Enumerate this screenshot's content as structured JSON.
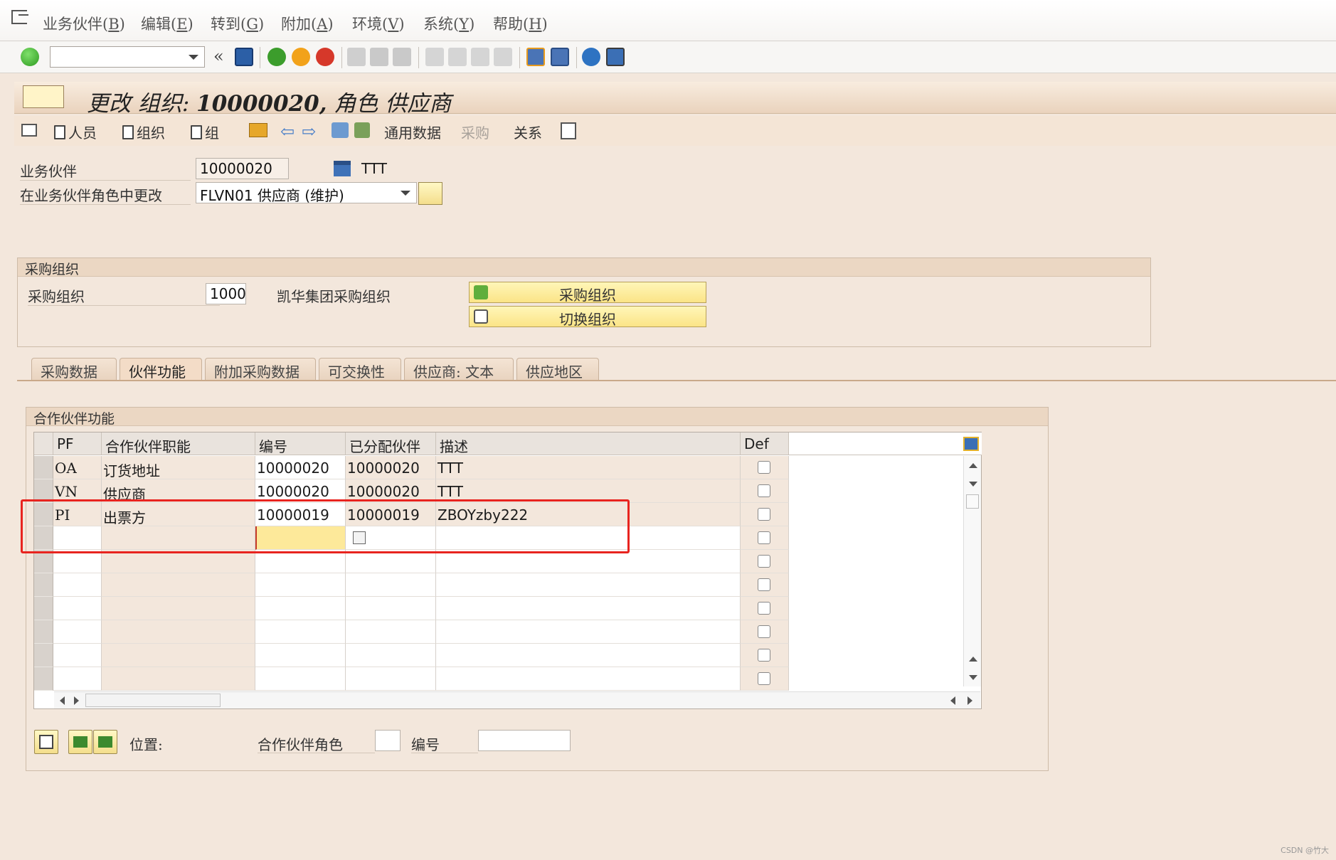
{
  "menu": {
    "items": [
      {
        "label": "业务伙伴(",
        "key": "B",
        "suffix": ")"
      },
      {
        "label": "编辑(",
        "key": "E",
        "suffix": ")"
      },
      {
        "label": "转到(",
        "key": "G",
        "suffix": ")"
      },
      {
        "label": "附加(",
        "key": "A",
        "suffix": ")"
      },
      {
        "label": "环境(",
        "key": "V",
        "suffix": ")"
      },
      {
        "label": "系统(",
        "key": "Y",
        "suffix": ")"
      },
      {
        "label": "帮助(",
        "key": "H",
        "suffix": ")"
      }
    ]
  },
  "title": {
    "prefix": "更改 组织: ",
    "number": "10000020,",
    "suffix": " 角色 供应商"
  },
  "app_toolbar": {
    "person": "人员",
    "organization": "组织",
    "group": "组",
    "general_data": "通用数据",
    "purchasing": "采购",
    "relations": "关系"
  },
  "header_fields": {
    "bp_label": "业务伙伴",
    "bp_value": "10000020",
    "bp_name": "TTT",
    "role_label": "在业务伙伴角色中更改",
    "role_value": "FLVN01 供应商 (维护)"
  },
  "purch_org_group": {
    "title": "采购组织",
    "field_label": "采购组织",
    "field_value": "1000",
    "field_desc": "凯华集团采购组织",
    "btn_purch_org": "采购组织",
    "btn_switch_org": "切换组织"
  },
  "tabs": [
    "采购数据",
    "伙伴功能",
    "附加采购数据",
    "可交换性",
    "供应商: 文本",
    "供应地区"
  ],
  "active_tab": "伙伴功能",
  "partner_group": {
    "title": "合作伙伴功能",
    "columns": [
      "PF",
      "合作伙伴职能",
      "编号",
      "已分配伙伴",
      "描述",
      "Def"
    ],
    "rows": [
      {
        "pf": "OA",
        "function": "订货地址",
        "number": "10000020",
        "partner": "10000020",
        "desc": "TTT",
        "def": false
      },
      {
        "pf": "VN",
        "function": "供应商",
        "number": "10000020",
        "partner": "10000020",
        "desc": "TTT",
        "def": false
      },
      {
        "pf": "PI",
        "function": "出票方",
        "number": "10000019",
        "partner": "10000019",
        "desc": "ZBOYzby222",
        "def": false
      }
    ]
  },
  "footer": {
    "position_label": "位置:",
    "role_label": "合作伙伴角色",
    "role_value": "",
    "number_label": "编号",
    "number_value": ""
  },
  "watermark": "CSDN @竹大",
  "colors": {
    "background": "#f3e7dc",
    "highlight_box": "#e8241f",
    "focused_cell": "#fde99a",
    "button_yellow": "#fbe487"
  }
}
